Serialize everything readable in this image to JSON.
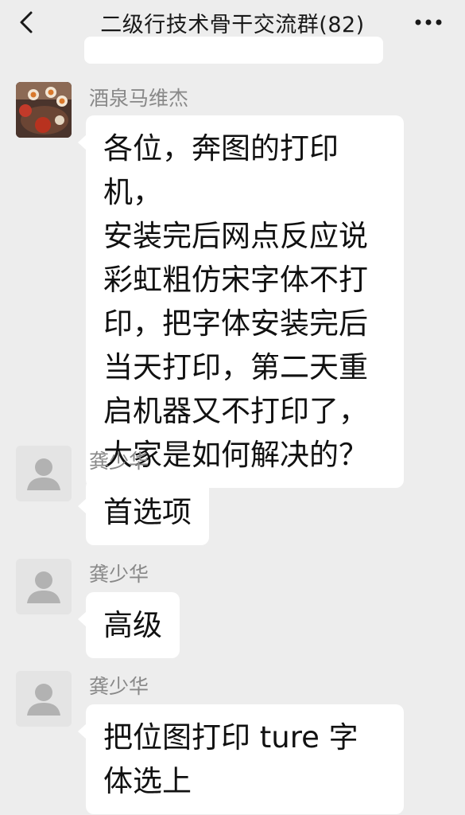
{
  "header": {
    "title": "二级行技术骨干交流群(82)",
    "back_icon": "chevron-left-icon",
    "more_icon": "more-horizontal-icon"
  },
  "messages": [
    {
      "sender": "酒泉马维杰",
      "text": "各位，奔图的打印机，\n安装完后网点反应说\n彩虹粗仿宋字体不打\n印，把字体安装完后\n当天打印，第二天重\n启机器又不打印了，\n大家是如何解决的？"
    },
    {
      "sender": "龚少华",
      "text": "首选项"
    },
    {
      "sender": "龚少华",
      "text": "高级"
    },
    {
      "sender": "龚少华",
      "text": "把位图打印 ture 字\n体选上"
    }
  ]
}
